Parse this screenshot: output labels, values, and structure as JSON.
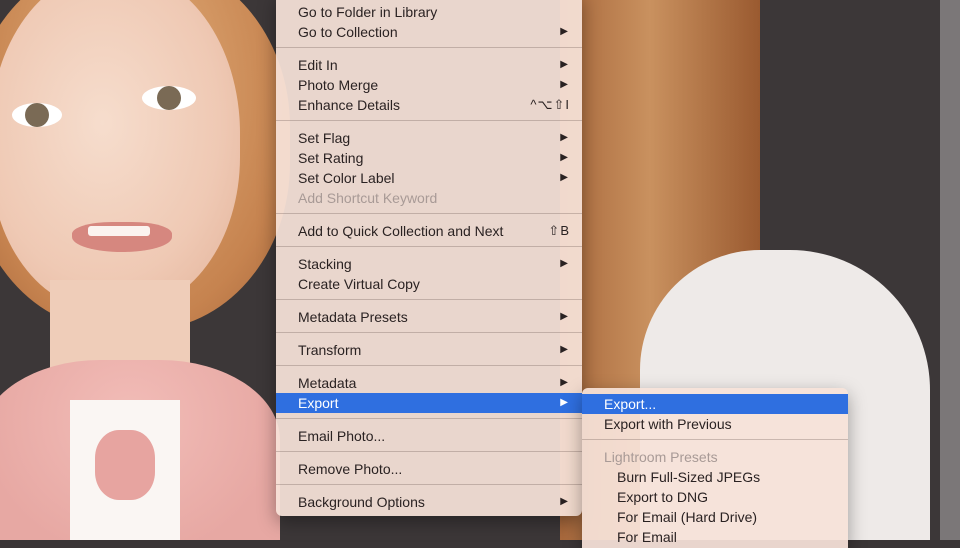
{
  "main_menu": {
    "items": [
      {
        "label": "Go to Folder in Library",
        "arrow": "",
        "shortcut": ""
      },
      {
        "label": "Go to Collection",
        "arrow": "▶",
        "shortcut": ""
      },
      {
        "label": "Edit In",
        "arrow": "▶",
        "shortcut": ""
      },
      {
        "label": "Photo Merge",
        "arrow": "▶",
        "shortcut": ""
      },
      {
        "label": "Enhance Details",
        "arrow": "",
        "shortcut": "^⌥⇧I"
      },
      {
        "label": "Set Flag",
        "arrow": "▶",
        "shortcut": ""
      },
      {
        "label": "Set Rating",
        "arrow": "▶",
        "shortcut": ""
      },
      {
        "label": "Set Color Label",
        "arrow": "▶",
        "shortcut": ""
      },
      {
        "label": "Add Shortcut Keyword",
        "arrow": "",
        "shortcut": ""
      },
      {
        "label": "Add to Quick Collection and Next",
        "arrow": "",
        "shortcut": "⇧B"
      },
      {
        "label": "Stacking",
        "arrow": "▶",
        "shortcut": ""
      },
      {
        "label": "Create Virtual Copy",
        "arrow": "",
        "shortcut": ""
      },
      {
        "label": "Metadata Presets",
        "arrow": "▶",
        "shortcut": ""
      },
      {
        "label": "Transform",
        "arrow": "▶",
        "shortcut": ""
      },
      {
        "label": "Metadata",
        "arrow": "▶",
        "shortcut": ""
      },
      {
        "label": "Export",
        "arrow": "▶",
        "shortcut": ""
      },
      {
        "label": "Email Photo...",
        "arrow": "",
        "shortcut": ""
      },
      {
        "label": "Remove Photo...",
        "arrow": "",
        "shortcut": ""
      },
      {
        "label": "Background Options",
        "arrow": "▶",
        "shortcut": ""
      }
    ]
  },
  "submenu": {
    "items": [
      {
        "label": "Export..."
      },
      {
        "label": "Export with Previous"
      },
      {
        "label": "Lightroom Presets"
      },
      {
        "label": "Burn Full-Sized JPEGs"
      },
      {
        "label": "Export to DNG"
      },
      {
        "label": "For Email (Hard Drive)"
      },
      {
        "label": "For Email"
      }
    ]
  },
  "colors": {
    "highlight": "#2f6fe0",
    "menu_bg": "#f6e2d8",
    "disabled_text": "#a89a96"
  }
}
